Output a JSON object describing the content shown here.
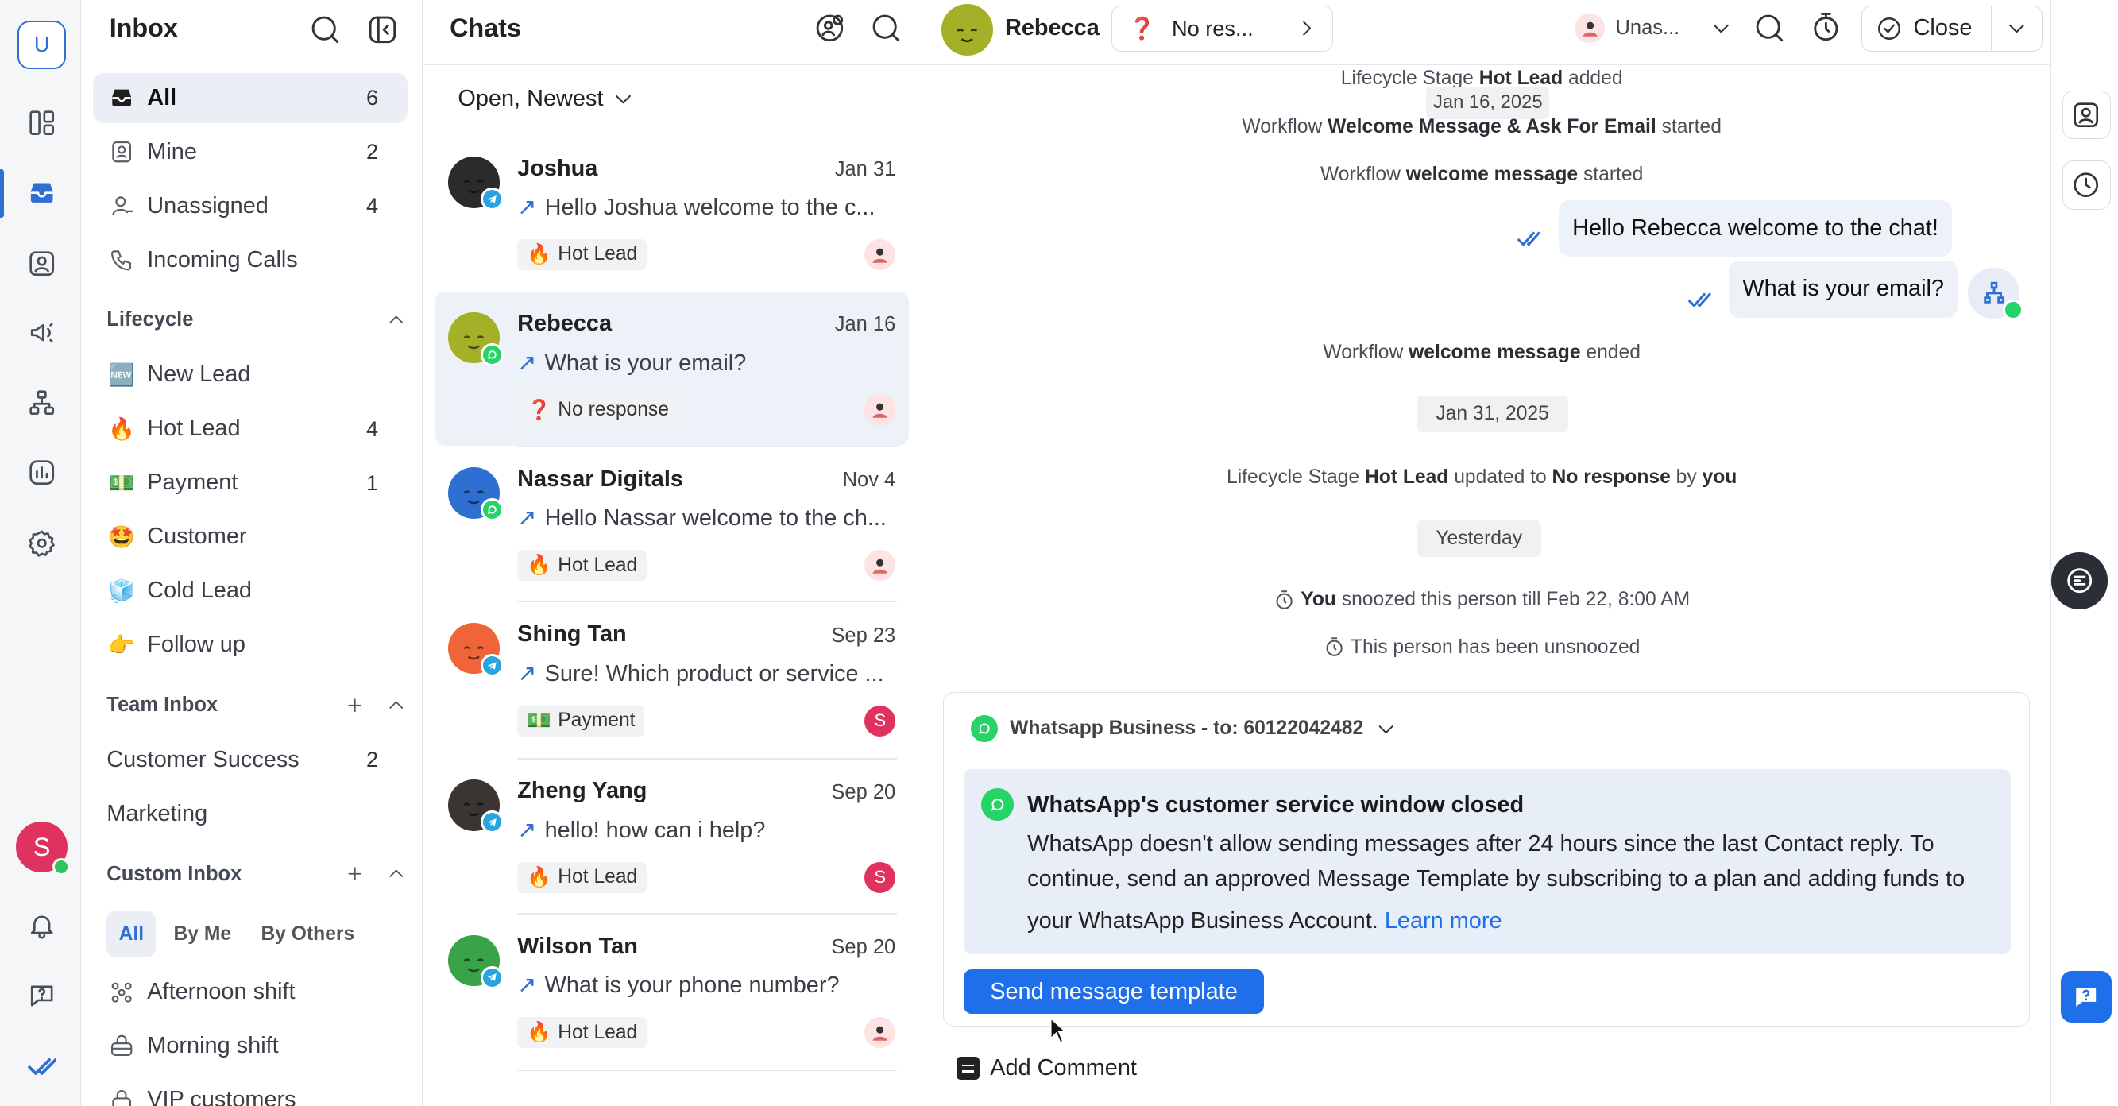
{
  "workspace": {
    "initial": "U"
  },
  "user": {
    "initial": "S"
  },
  "sidebar": {
    "title": "Inbox",
    "items": [
      {
        "label": "All",
        "count": "6",
        "icon": "inbox-icon"
      },
      {
        "label": "Mine",
        "count": "2",
        "icon": "user-badge-icon"
      },
      {
        "label": "Unassigned",
        "count": "4",
        "icon": "user-unassigned-icon"
      },
      {
        "label": "Incoming Calls",
        "count": "",
        "icon": "phone-icon"
      }
    ],
    "lifecycle": {
      "title": "Lifecycle",
      "items": [
        {
          "emoji": "🆕",
          "label": "New Lead",
          "count": ""
        },
        {
          "emoji": "🔥",
          "label": "Hot Lead",
          "count": "4"
        },
        {
          "emoji": "💵",
          "label": "Payment",
          "count": "1"
        },
        {
          "emoji": "🤩",
          "label": "Customer",
          "count": ""
        },
        {
          "emoji": "🧊",
          "label": "Cold Lead",
          "count": ""
        },
        {
          "emoji": "👉",
          "label": "Follow up",
          "count": ""
        }
      ]
    },
    "team_inbox": {
      "title": "Team Inbox",
      "items": [
        {
          "label": "Customer Success",
          "count": "2"
        },
        {
          "label": "Marketing",
          "count": ""
        }
      ]
    },
    "custom_inbox": {
      "title": "Custom Inbox",
      "filters": [
        "All",
        "By Me",
        "By Others"
      ],
      "items": [
        {
          "label": "Afternoon shift",
          "icon": "team-icon"
        },
        {
          "label": "Morning shift",
          "icon": "briefcase-icon"
        },
        {
          "label": "VIP customers",
          "icon": "lock-icon"
        }
      ]
    }
  },
  "chatlist": {
    "title": "Chats",
    "filter": "Open, Newest",
    "chats": [
      {
        "name": "Joshua",
        "date": "Jan 31",
        "preview": "Hello Joshua welcome to the c...",
        "tag_emoji": "🔥",
        "tag": "Hot Lead",
        "channel": "telegram",
        "assignee": "unassigned",
        "avatar_color": "#2b2b2b"
      },
      {
        "name": "Rebecca",
        "date": "Jan 16",
        "preview": "What is your email?",
        "tag_emoji": "❓",
        "tag": "No response",
        "channel": "whatsapp",
        "assignee": "unassigned",
        "avatar_color": "#a3b028"
      },
      {
        "name": "Nassar Digitals",
        "date": "Nov 4",
        "preview": "Hello Nassar welcome to the ch...",
        "tag_emoji": "🔥",
        "tag": "Hot Lead",
        "channel": "whatsapp",
        "assignee": "unassigned",
        "avatar_color": "#2f6fd1"
      },
      {
        "name": "Shing Tan",
        "date": "Sep 23",
        "preview": "Sure! Which product or service ...",
        "tag_emoji": "💵",
        "tag": "Payment",
        "channel": "telegram",
        "assignee": "S",
        "avatar_color": "#f0643a"
      },
      {
        "name": "Zheng Yang",
        "date": "Sep 20",
        "preview": "hello! how can i help?",
        "tag_emoji": "🔥",
        "tag": "Hot Lead",
        "channel": "telegram",
        "assignee": "S",
        "avatar_color": "#3a3530"
      },
      {
        "name": "Wilson Tan",
        "date": "Sep 20",
        "preview": "What is your phone number?",
        "tag_emoji": "🔥",
        "tag": "Hot Lead",
        "channel": "telegram",
        "assignee": "unassigned",
        "avatar_color": "#3aa34a"
      }
    ]
  },
  "conversation": {
    "contact_name": "Rebecca",
    "status_emoji": "❓",
    "status_label": "No res...",
    "assignee_label": "Unas...",
    "close_label": "Close",
    "events": {
      "e1_pre": "Lifecycle Stage ",
      "e1_bold": "Hot Lead",
      "e1_post": " added",
      "date_pill_1": "Jan 16, 2025",
      "e2_pre": "Workflow ",
      "e2_bold": "Welcome Message & Ask For Email",
      "e2_post": " started",
      "e3_pre": "Workflow ",
      "e3_bold": "welcome message",
      "e3_post": " started",
      "e4_pre": "Workflow ",
      "e4_bold": "welcome message",
      "e4_post": " ended",
      "date_pill_2": "Jan 31, 2025",
      "e5_pre": "Lifecycle Stage ",
      "e5_bold": "Hot Lead",
      "e5_mid": " updated to ",
      "e5_bold2": "No response",
      "e5_mid2": " by ",
      "e5_bold3": "you",
      "date_pill_3": "Yesterday",
      "e6_bold": "You",
      "e6_post": " snoozed this person till Feb 22, 8:00 AM",
      "e7": "This person has been unsnoozed"
    },
    "messages": [
      {
        "text": "Hello Rebecca welcome to the chat!"
      },
      {
        "text": "What is your email?"
      }
    ],
    "composer": {
      "channel_label": "Whatsapp Business - to: 60122042482",
      "notice_title": "WhatsApp's customer service window closed",
      "notice_line1": "WhatsApp doesn't allow sending messages after 24 hours since the last Contact reply. To",
      "notice_line2": "continue, send an approved Message Template by subscribing to a plan and adding funds to",
      "notice_line3": "your WhatsApp Business Account. ",
      "learn_more": "Learn more",
      "template_button": "Send message template",
      "add_comment": "Add Comment"
    }
  },
  "colors": {
    "accent": "#1f6feb",
    "whatsapp": "#25d366",
    "telegram": "#2aa3e1",
    "user_avatar": "#e0325f"
  }
}
